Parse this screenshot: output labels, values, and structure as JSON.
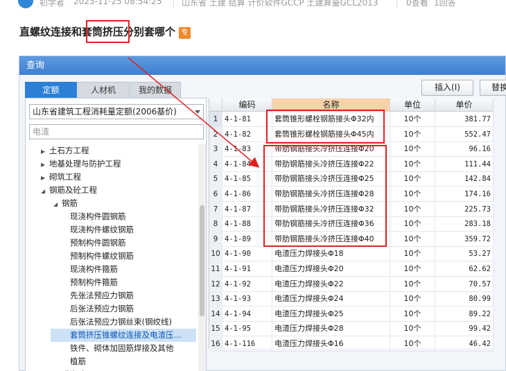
{
  "meta": {
    "author": "初学者",
    "datetime": "2023-11-25 08:54:25",
    "tags": "山东省 土建 结算 计价软件GCCP 土建算量GCL2013",
    "views": "0查看",
    "answers": "1回答"
  },
  "question": {
    "title_part1": "直螺纹连接和",
    "title_highlight": "套筒挤压",
    "title_part2": "分别套哪个",
    "badge": "专"
  },
  "window": {
    "title": "查询",
    "tabs": [
      "定额",
      "人材机",
      "我的数据"
    ],
    "insert_button": "插入(I)",
    "replace_button": "替换",
    "quota_select": "山东省建筑工程消耗量定额(2006基价)",
    "search_placeholder": "电渣"
  },
  "tree": [
    {
      "label": "土石方工程",
      "level": 1,
      "toggle": "▶"
    },
    {
      "label": "地基处理与防护工程",
      "level": 1,
      "toggle": "▶"
    },
    {
      "label": "砌筑工程",
      "level": 1,
      "toggle": "▶"
    },
    {
      "label": "钢筋及砼工程",
      "level": 1,
      "toggle": "◢"
    },
    {
      "label": "钢筋",
      "level": 2,
      "toggle": "◢"
    },
    {
      "label": "现浇构件圆钢筋",
      "level": 3,
      "toggle": ""
    },
    {
      "label": "现浇构件螺纹钢筋",
      "level": 3,
      "toggle": ""
    },
    {
      "label": "预制构件圆钢筋",
      "level": 3,
      "toggle": ""
    },
    {
      "label": "预制构件螺纹钢筋",
      "level": 3,
      "toggle": ""
    },
    {
      "label": "现浇构件箍筋",
      "level": 3,
      "toggle": ""
    },
    {
      "label": "预制构件箍筋",
      "level": 3,
      "toggle": ""
    },
    {
      "label": "先张法预应力钢筋",
      "level": 3,
      "toggle": ""
    },
    {
      "label": "后张法预应力钢筋",
      "level": 3,
      "toggle": ""
    },
    {
      "label": "后张法预应力钢丝束(钢绞线)",
      "level": 3,
      "toggle": ""
    },
    {
      "label": "套筒挤压锥螺纹连接及电渣压...",
      "level": 3,
      "toggle": "",
      "selected": true
    },
    {
      "label": "铁件、砌体加固筋焊接及其他",
      "level": 3,
      "toggle": ""
    },
    {
      "label": "植筋",
      "level": 3,
      "toggle": ""
    },
    {
      "label": "现浇砼",
      "level": 2,
      "toggle": "▶"
    }
  ],
  "grid": {
    "columns": [
      "编码",
      "名称",
      "单位",
      "单价"
    ],
    "rows": [
      {
        "n": "1",
        "code": "4-1-81",
        "name": "套筒锥形螺栓钢筋接头Φ32内",
        "unit": "10个",
        "price": "381.77"
      },
      {
        "n": "2",
        "code": "4-1-82",
        "name": "套筒锥形螺栓钢筋接头Φ45内",
        "unit": "10个",
        "price": "552.47"
      },
      {
        "n": "3",
        "code": "4-1-83",
        "name": "带肋钢筋接头冷挤压连接Φ20",
        "unit": "10个",
        "price": "96.16"
      },
      {
        "n": "4",
        "code": "4-1-84",
        "name": "带肋钢筋接头冷挤压连接Φ22",
        "unit": "10个",
        "price": "111.44"
      },
      {
        "n": "5",
        "code": "4-1-85",
        "name": "带肋钢筋接头冷挤压连接Φ25",
        "unit": "10个",
        "price": "142.84"
      },
      {
        "n": "6",
        "code": "4-1-86",
        "name": "带肋钢筋接头冷挤压连接Φ28",
        "unit": "10个",
        "price": "174.16"
      },
      {
        "n": "7",
        "code": "4-1-87",
        "name": "带肋钢筋接头冷挤压连接Φ32",
        "unit": "10个",
        "price": "225.73"
      },
      {
        "n": "8",
        "code": "4-1-88",
        "name": "带肋钢筋接头冷挤压连接Φ36",
        "unit": "10个",
        "price": "283.18"
      },
      {
        "n": "9",
        "code": "4-1-89",
        "name": "带肋钢筋接头冷挤压连接Φ40",
        "unit": "10个",
        "price": "359.72"
      },
      {
        "n": "10",
        "code": "4-1-90",
        "name": "电渣压力焊接头Φ18",
        "unit": "10个",
        "price": "53.27"
      },
      {
        "n": "11",
        "code": "4-1-91",
        "name": "电渣压力焊接头Φ20",
        "unit": "10个",
        "price": "62.62"
      },
      {
        "n": "12",
        "code": "4-1-92",
        "name": "电渣压力焊接头Φ22",
        "unit": "10个",
        "price": "70.57"
      },
      {
        "n": "13",
        "code": "4-1-93",
        "name": "电渣压力焊接头Φ24",
        "unit": "10个",
        "price": "80.99"
      },
      {
        "n": "14",
        "code": "4-1-94",
        "name": "电渣压力焊接头Φ25",
        "unit": "10个",
        "price": "89.22"
      },
      {
        "n": "15",
        "code": "4-1-95",
        "name": "电渣压力焊接头Φ28",
        "unit": "10个",
        "price": "99.42"
      },
      {
        "n": "16",
        "code": "4-1-116",
        "name": "电渣压力焊接头Φ16",
        "unit": "10个",
        "price": "46.42"
      }
    ]
  },
  "colors": {
    "titlebar": "#3f7ecf",
    "active_tab": "#2b7fd6",
    "annotation": "#e02020",
    "badge": "#f08a2c",
    "name_header": "#f8d2a8"
  }
}
